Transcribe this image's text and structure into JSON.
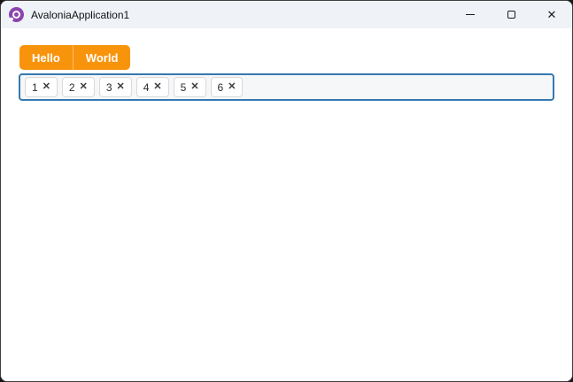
{
  "window": {
    "title": "AvaloniaApplication1",
    "buttons": [
      {
        "name": "minimize",
        "icon": "minimize-icon"
      },
      {
        "name": "maximize",
        "icon": "maximize-icon"
      },
      {
        "name": "close",
        "icon": "close-icon",
        "glyph": "✕"
      }
    ]
  },
  "tabbar": {
    "items": [
      {
        "label": "Hello"
      },
      {
        "label": "World"
      }
    ]
  },
  "chips": {
    "items": [
      {
        "label": "1"
      },
      {
        "label": "2"
      },
      {
        "label": "3"
      },
      {
        "label": "4"
      },
      {
        "label": "5"
      },
      {
        "label": "6"
      }
    ],
    "remove_icon": "✕"
  },
  "colors": {
    "accent_orange": "#F8940C",
    "focus_border": "#3578B1",
    "titlebar_bg": "#EFF3F8",
    "logo_purple": "#8B44AC"
  }
}
